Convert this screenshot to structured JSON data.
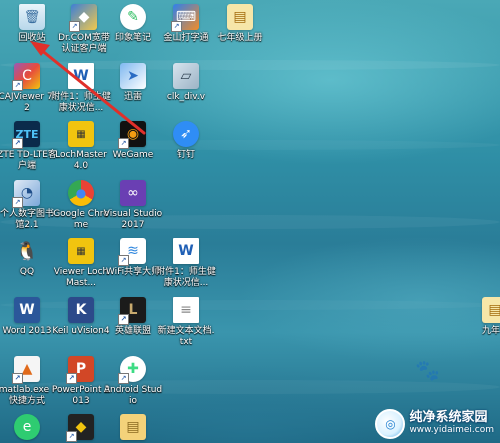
{
  "desktop": {
    "icons": [
      {
        "label": "回收站",
        "icon": "recycle-bin-icon",
        "glyph": "🗑"
      },
      {
        "label": "Dr.COM宽带认证客户端",
        "icon": "drcom-icon",
        "glyph": "◆"
      },
      {
        "label": "印象笔记",
        "icon": "evernote-icon",
        "glyph": "✎"
      },
      {
        "label": "金山打字通",
        "icon": "kingsoft-typing-icon",
        "glyph": "⌨"
      },
      {
        "label": "七年级上册",
        "icon": "textbook-folder-icon",
        "glyph": "▤"
      },
      {
        "label": "CAJViewer 7.2",
        "icon": "cajviewer-icon",
        "glyph": "C"
      },
      {
        "label": "附件1：师生健康状况信...",
        "icon": "word-document-icon",
        "glyph": "W"
      },
      {
        "label": "迅雷",
        "icon": "xunlei-icon",
        "glyph": "➤"
      },
      {
        "label": "clk_div.v",
        "icon": "verilog-file-icon",
        "glyph": "▱"
      },
      {
        "label": "ZTE TD-LTE客户端",
        "icon": "zte-icon",
        "glyph": "ZTE"
      },
      {
        "label": "LochMaster 4.0",
        "icon": "lochmaster-icon",
        "glyph": "▦"
      },
      {
        "label": "WeGame",
        "icon": "wegame-icon",
        "glyph": "◉"
      },
      {
        "label": "钉钉",
        "icon": "dingtalk-icon",
        "glyph": "➶"
      },
      {
        "label": "个人数字图书馆2.1",
        "icon": "digital-library-icon",
        "glyph": "◔"
      },
      {
        "label": "Google Chrome",
        "icon": "chrome-icon",
        "glyph": "●"
      },
      {
        "label": "Visual Studio 2017",
        "icon": "visual-studio-icon",
        "glyph": "∞"
      },
      {
        "label": "QQ",
        "icon": "qq-icon",
        "glyph": "🐧"
      },
      {
        "label": "Viewer LochMast...",
        "icon": "lochmaster-viewer-icon",
        "glyph": "▦"
      },
      {
        "label": "WiFi共享大师",
        "icon": "wifi-icon",
        "glyph": "≋"
      },
      {
        "label": "附件1：师生健康状况信...",
        "icon": "word-document-icon",
        "glyph": "W"
      },
      {
        "label": "Word 2013",
        "icon": "word-icon",
        "glyph": "W"
      },
      {
        "label": "Keil uVision4",
        "icon": "keil-icon",
        "glyph": "K"
      },
      {
        "label": "英雄联盟",
        "icon": "league-of-legends-icon",
        "glyph": "L"
      },
      {
        "label": "新建文本文档.txt",
        "icon": "text-file-icon",
        "glyph": "≡"
      },
      {
        "label": "九年",
        "icon": "textbook-folder-icon",
        "glyph": "▤"
      },
      {
        "label": "matlab.exe - 快捷方式",
        "icon": "matlab-icon",
        "glyph": "▲"
      },
      {
        "label": "PowerPoint 2013",
        "icon": "powerpoint-icon",
        "glyph": "P"
      },
      {
        "label": "Android Studio",
        "icon": "android-studio-icon",
        "glyph": "✚"
      },
      {
        "label": "",
        "icon": "green-app-icon",
        "glyph": "e"
      },
      {
        "label": "",
        "icon": "app-icon",
        "glyph": "◆"
      },
      {
        "label": "",
        "icon": "folder-icon",
        "glyph": "▤"
      }
    ]
  },
  "watermark": {
    "title": "纯净系统家园",
    "url": "www.yidaimei.com",
    "logo_glyph": "◎"
  },
  "colors": {
    "annotation_arrow": "#e0302a",
    "label_text": "#ffffff"
  }
}
